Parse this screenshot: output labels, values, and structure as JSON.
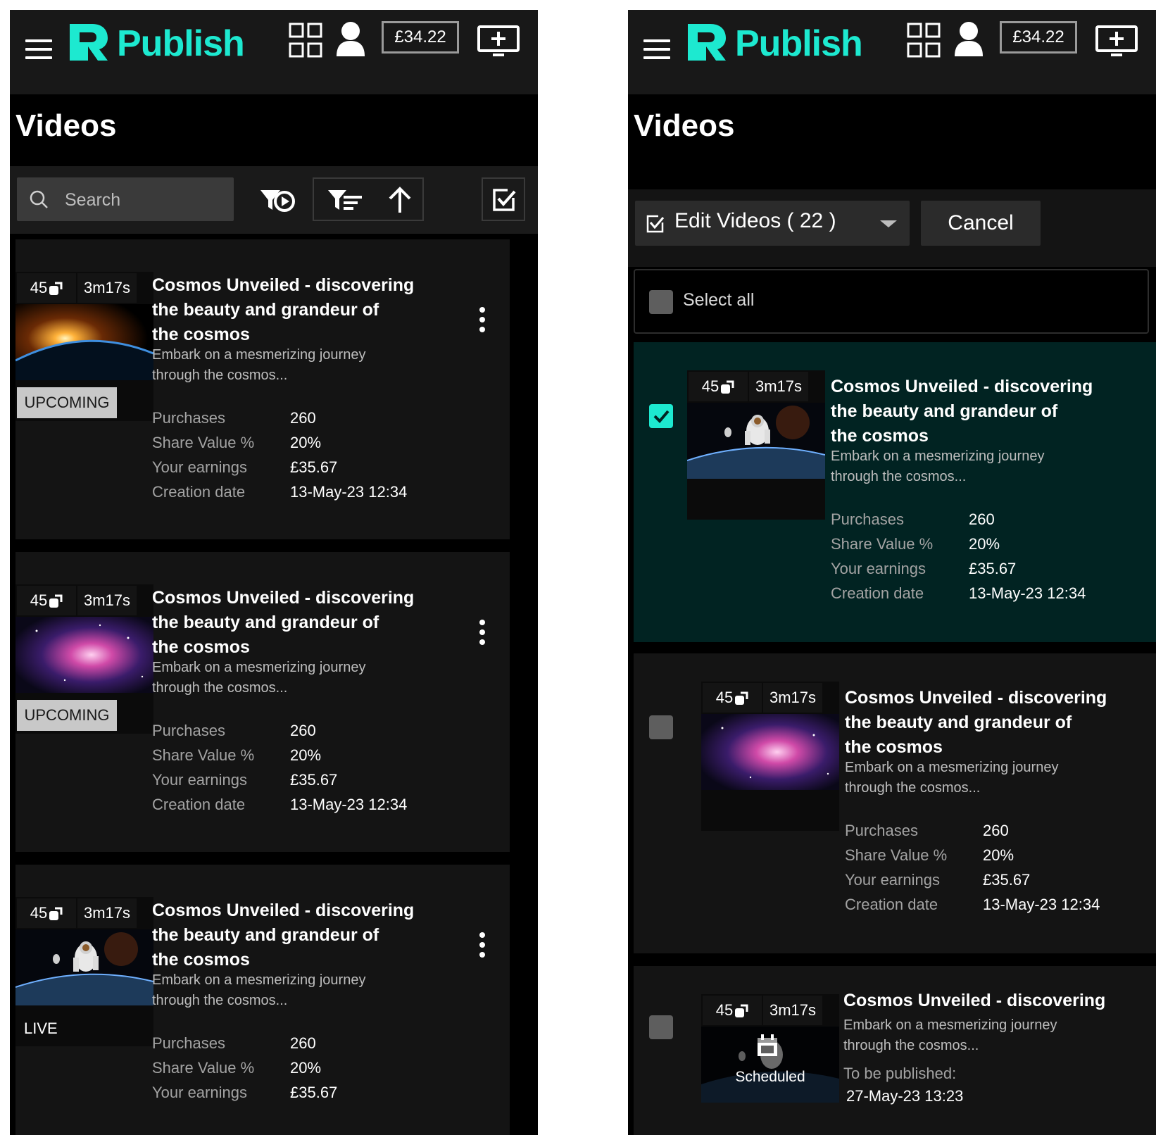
{
  "header": {
    "logo_text": "Publish",
    "balance": "£34.22"
  },
  "page": {
    "title": "Videos"
  },
  "left_toolbar": {
    "search_placeholder": "Search"
  },
  "right_toolbar": {
    "edit_label": "Edit Videos ( 22 )",
    "cancel_label": "Cancel",
    "select_all_label": "Select all"
  },
  "labels": {
    "purchases": "Purchases",
    "share_value": "Share Value %",
    "your_earnings": "Your earnings",
    "creation_date": "Creation date",
    "to_be_published": "To be published:"
  },
  "left_videos": [
    {
      "count": "45",
      "duration": "3m17s",
      "title_line1": "Cosmos Unveiled - discovering",
      "title_line2": "the beauty and grandeur of",
      "title_line3": "the cosmos",
      "desc_line1": "Embark on a mesmerizing journey",
      "desc_line2": "through the cosmos...",
      "status": "UPCOMING",
      "thumb": "sunrise-earth",
      "purchases": "260",
      "share_value": "20%",
      "earnings": "£35.67",
      "creation_date": "13-May-23 12:34"
    },
    {
      "count": "45",
      "duration": "3m17s",
      "title_line1": "Cosmos Unveiled - discovering",
      "title_line2": "the beauty and grandeur of",
      "title_line3": "the cosmos",
      "desc_line1": "Embark on a mesmerizing journey",
      "desc_line2": "through the cosmos...",
      "status": "UPCOMING",
      "thumb": "nebula",
      "purchases": "260",
      "share_value": "20%",
      "earnings": "£35.67",
      "creation_date": "13-May-23 12:34"
    },
    {
      "count": "45",
      "duration": "3m17s",
      "title_line1": "Cosmos Unveiled - discovering",
      "title_line2": "the beauty and grandeur of",
      "title_line3": "the cosmos",
      "desc_line1": "Embark on a mesmerizing journey",
      "desc_line2": "through the cosmos...",
      "status": "LIVE",
      "thumb": "astronaut-earth",
      "purchases": "260",
      "share_value": "20%",
      "earnings": "£35.67",
      "creation_date": ""
    }
  ],
  "right_videos": [
    {
      "selected": true,
      "count": "45",
      "duration": "3m17s",
      "title_line1": "Cosmos Unveiled - discovering",
      "title_line2": "the beauty and grandeur of",
      "title_line3": "the cosmos",
      "desc_line1": "Embark on a mesmerizing journey",
      "desc_line2": "through the cosmos...",
      "thumb": "astronaut-earth",
      "purchases": "260",
      "share_value": "20%",
      "earnings": "£35.67",
      "creation_date": "13-May-23 12:34"
    },
    {
      "selected": false,
      "count": "45",
      "duration": "3m17s",
      "title_line1": "Cosmos Unveiled - discovering",
      "title_line2": "the beauty and grandeur of",
      "title_line3": "the cosmos",
      "desc_line1": "Embark on a mesmerizing journey",
      "desc_line2": "through the cosmos...",
      "thumb": "nebula",
      "purchases": "260",
      "share_value": "20%",
      "earnings": "£35.67",
      "creation_date": "13-May-23 12:34"
    },
    {
      "selected": false,
      "count": "45",
      "duration": "3m17s",
      "title_line1": "Cosmos Unveiled - discovering",
      "desc_line1": "Embark on a mesmerizing journey",
      "desc_line2": "through the cosmos...",
      "thumb": "astronaut-earth",
      "overlay": "Scheduled",
      "publish_date": "27-May-23 13:23"
    }
  ],
  "icons": {
    "menu": "hamburger-icon",
    "grid": "grid-icon",
    "user": "user-icon",
    "add": "add-screen-icon",
    "search": "search-icon",
    "filter_play": "filter-play-icon",
    "sort_filter": "sort-filter-icon",
    "sort_direction": "arrow-up-icon",
    "select_mode": "checkbox-icon",
    "more": "kebab-icon",
    "share": "share-icon",
    "calendar": "calendar-icon"
  },
  "colors": {
    "accent": "#1de9d0",
    "background": "#000000",
    "card": "#141414",
    "selected_card": "#012322",
    "badge_upcoming": "#c8c8c8"
  }
}
